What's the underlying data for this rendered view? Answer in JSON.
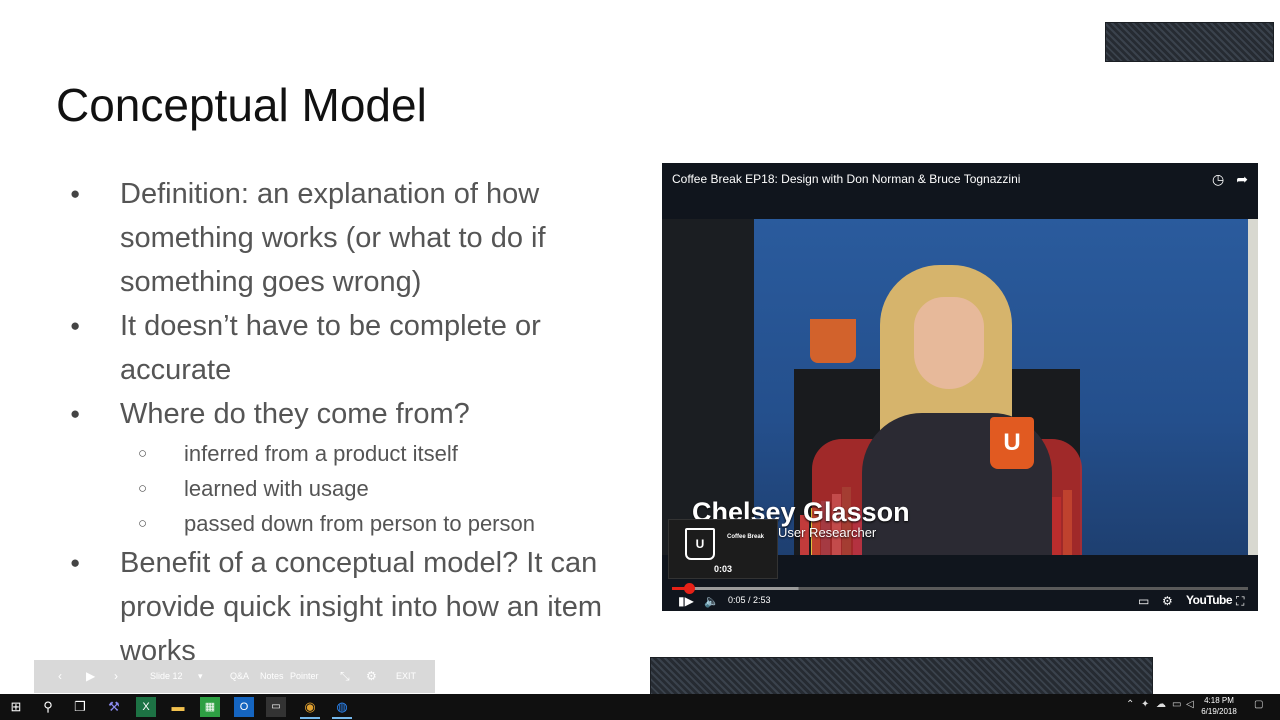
{
  "slide": {
    "title": "Conceptual Model",
    "bullets": [
      {
        "level": 1,
        "text": "Definition: an explanation of how something works (or what to do if something goes wrong)"
      },
      {
        "level": 1,
        "text": "It doesn’t have to be complete or accurate"
      },
      {
        "level": 1,
        "text": "Where do they come from?"
      },
      {
        "level": 2,
        "text": "inferred from a product itself"
      },
      {
        "level": 2,
        "text": "learned with usage"
      },
      {
        "level": 2,
        "text": "passed down from person to person"
      },
      {
        "level": 1,
        "text": "Benefit of a conceptual model? It can provide quick insight into how an item works"
      }
    ]
  },
  "video": {
    "title": "Coffee Break EP18: Design with Don Norman & Bruce Tognazzini",
    "caption_name": "Chelsey Glasson",
    "caption_role": "User Researcher",
    "mug_letter": "U",
    "thumbnail": {
      "cup_letter": "U",
      "label": "Coffee Break",
      "time": "0:03"
    },
    "current_time": "0:05",
    "duration": "2:53",
    "time_display": "0:05 / 2:53",
    "progress_fraction": 0.029,
    "buffered_fraction": 0.22,
    "brand": "YouTube",
    "icons": {
      "watch_later": "clock-icon",
      "share": "share-icon",
      "play": "play-pause-icon",
      "volume": "volume-icon",
      "captions": "captions-icon",
      "settings": "gear-icon",
      "fullscreen": "fullscreen-icon"
    },
    "accent_color": "#e62117"
  },
  "presenter_toolbar": {
    "slide_label": "Slide 12",
    "qa_label": "Q&A",
    "notes_label": "Notes",
    "pointer_label": "Pointer",
    "exit_label": "EXIT"
  },
  "taskbar": {
    "time": "4:18 PM",
    "date": "6/19/2018",
    "apps": [
      "start-icon",
      "search-icon",
      "task-view-icon",
      "settings-app-icon",
      "excel-icon",
      "file-explorer-icon",
      "sheets-icon",
      "outlook-icon",
      "terminal-icon",
      "chrome-icon",
      "browser-app-icon"
    ]
  }
}
